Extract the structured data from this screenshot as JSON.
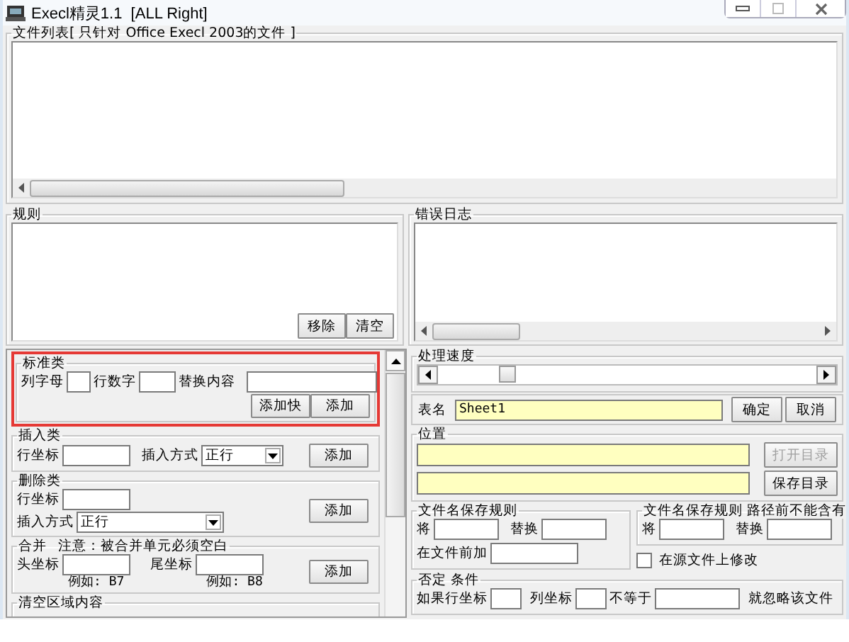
{
  "window": {
    "title": "Execl精灵1.1  [ALL Right]"
  },
  "file_list": {
    "title": "文件列表[ 只针对 Office Execl 2003的文件 ]"
  },
  "rules": {
    "title": "规则",
    "buttons": [
      "移除",
      "清空"
    ]
  },
  "error_log": {
    "title": "错误日志"
  },
  "standard": {
    "title": "标准类",
    "highlighted": true,
    "fields": [
      {
        "label": "列字母"
      },
      {
        "label": "行数字"
      },
      {
        "label": "替换内容"
      }
    ],
    "buttons": [
      "添加快",
      "添加"
    ]
  },
  "insert": {
    "title": "插入类",
    "row_label": "行坐标",
    "mode_label": "插入方式",
    "mode_value": "正行",
    "button": "添加"
  },
  "delete": {
    "title": "删除类",
    "row_label": "行坐标",
    "mode_label": "插入方式",
    "mode_value": "正行",
    "button": "添加"
  },
  "merge": {
    "title": "合并",
    "note": "注意：被合并单元必须空白",
    "head_label": "头坐标",
    "head_example": "例如: B7",
    "tail_label": "尾坐标",
    "tail_example": "例如: B8",
    "button": "添加"
  },
  "clear": {
    "title": "清空区域内容"
  },
  "speed": {
    "title": "处理速度",
    "level": 0.17
  },
  "sheet": {
    "label": "表名",
    "value": "Sheet1",
    "buttons": [
      "确定",
      "取消"
    ]
  },
  "location": {
    "title": "位置",
    "buttons": [
      {
        "label": "打开目录",
        "disabled": true
      },
      {
        "label": "保存目录",
        "disabled": false
      }
    ]
  },
  "save_rule": {
    "title": "文件名保存规则",
    "replace_label": "将",
    "with_label": "替换",
    "prefix_label": "在文件前加"
  },
  "path_rule": {
    "title": "文件名保存规则  路径前不能含有",
    "replace_label": "将",
    "with_label": "替换"
  },
  "modify_source": {
    "label": "在源文件上修改",
    "checked": false
  },
  "negate": {
    "title": "否定 条件",
    "row_label": "如果行坐标",
    "col_label": "列坐标",
    "neq_label": "不等于",
    "tail": "就忽略该文件"
  }
}
